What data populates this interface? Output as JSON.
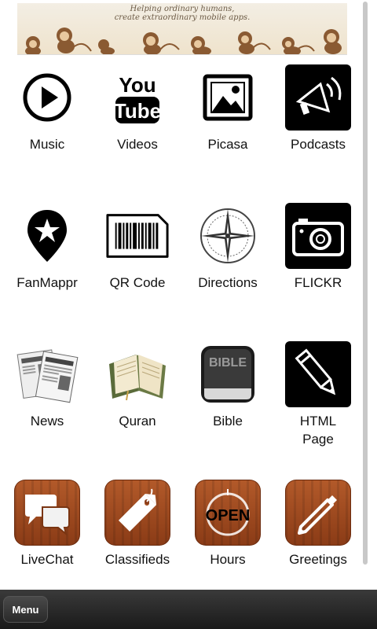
{
  "banner": {
    "tagline_1": "Helping ordinary humans,",
    "tagline_2": "create extraordinary mobile apps."
  },
  "tiles": [
    {
      "label": "Music",
      "icon": "play-circle-icon"
    },
    {
      "label": "Videos",
      "icon": "youtube-icon"
    },
    {
      "label": "Picasa",
      "icon": "picture-icon"
    },
    {
      "label": "Podcasts",
      "icon": "megaphone-icon"
    },
    {
      "label": "FanMappr",
      "icon": "map-pin-star-icon"
    },
    {
      "label": "QR Code",
      "icon": "barcode-icon"
    },
    {
      "label": "Directions",
      "icon": "compass-icon"
    },
    {
      "label": "FLICKR",
      "icon": "camera-icon"
    },
    {
      "label": "News",
      "icon": "newspaper-icon"
    },
    {
      "label": "Quran",
      "icon": "open-book-icon"
    },
    {
      "label": "Bible",
      "icon": "bible-icon"
    },
    {
      "label": "HTML Page",
      "icon": "pencil-icon"
    },
    {
      "label": "LiveChat",
      "icon": "chat-bubbles-icon"
    },
    {
      "label": "Classifieds",
      "icon": "price-tag-icon"
    },
    {
      "label": "Hours",
      "icon": "open-sign-icon",
      "icon_text": "OPEN"
    },
    {
      "label": "Greetings",
      "icon": "pen-icon"
    }
  ],
  "bible_icon_text": "BIBLE",
  "bottom_bar": {
    "menu_label": "Menu"
  }
}
